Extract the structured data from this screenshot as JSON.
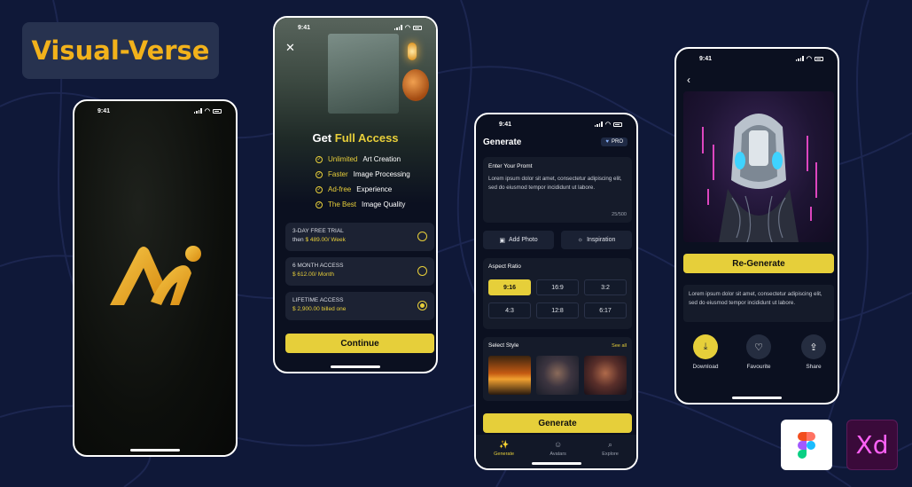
{
  "brand": {
    "title": "Visual-Verse"
  },
  "status_time": "9:41",
  "splash": {
    "logo": "ai-logo"
  },
  "paywall": {
    "title_prefix": "Get",
    "title_accent": "Full Access",
    "features": [
      {
        "accent": "Unlimited",
        "rest": "Art Creation"
      },
      {
        "accent": "Faster",
        "rest": "Image Processing"
      },
      {
        "accent": "Ad-free",
        "rest": "Experience"
      },
      {
        "accent": "The Best",
        "rest": "Image Quality"
      }
    ],
    "plans": [
      {
        "title": "3-DAY FREE TRIAL",
        "prefix": "then",
        "price": "$ 489.00/ Week",
        "selected": false
      },
      {
        "title": "6 MONTH ACCESS",
        "prefix": "",
        "price": "$ 612.00/ Month",
        "selected": false
      },
      {
        "title": "LIFETIME ACCESS",
        "prefix": "",
        "price": "$ 2,900.00 billed one",
        "selected": true
      }
    ],
    "continue_label": "Continue"
  },
  "generate": {
    "title": "Generate",
    "pro_label": "PRO",
    "prompt_label": "Enter Your Promt",
    "prompt_text": "Lorem ipsum dolor sit amet, consectetur adipiscing elit, sed do eiusmod tempor incididunt ut labore.",
    "char_count": "25/500",
    "add_photo": "Add Photo",
    "inspiration": "Inspiration",
    "aspect_label": "Aspect Ratio",
    "ratios": [
      "9:16",
      "16:9",
      "3:2",
      "4:3",
      "12:8",
      "6:17"
    ],
    "active_ratio": "9:16",
    "style_label": "Select Style",
    "see_all": "See all",
    "generate_button": "Generate",
    "tabs": [
      "Generate",
      "Avatars",
      "Explore"
    ]
  },
  "result": {
    "description": "Lorem ipsum dolor sit amet, consectetur adipiscing elit, sed do eiusmod tempor incididunt ut labore.",
    "regenerate_label": "Re-Generate",
    "actions": [
      "Download",
      "Favourite",
      "Share"
    ]
  },
  "tools": {
    "figma_icon": "figma-icon",
    "xd_label": "Xd"
  },
  "colors": {
    "accent": "#e6cf3a",
    "brand": "#f2b21b",
    "background": "#0f1838"
  }
}
